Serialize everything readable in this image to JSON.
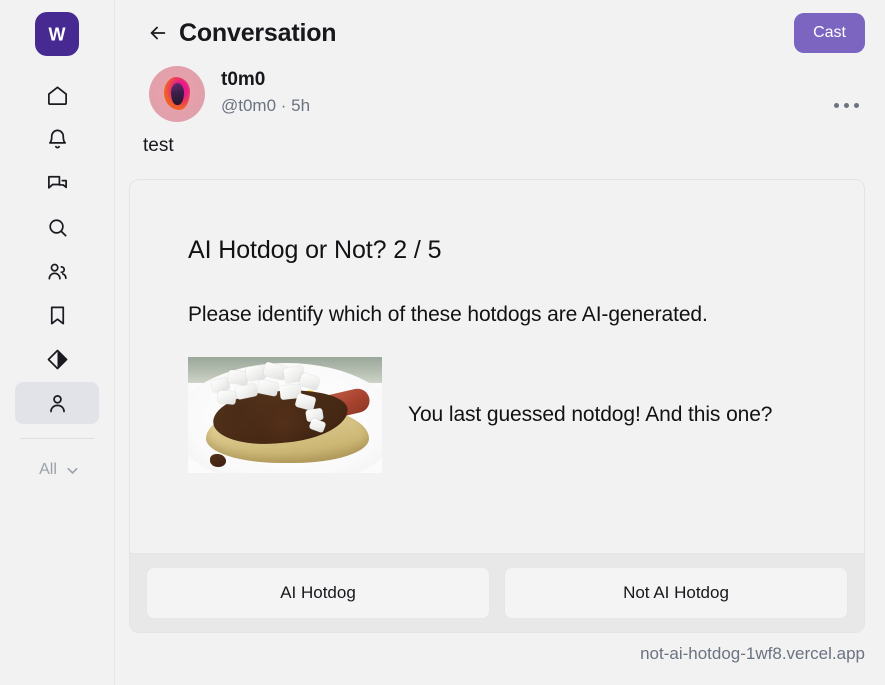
{
  "sidebar": {
    "logo_letter": "W",
    "logo_color": "#472A91",
    "items": [
      {
        "icon": "home-icon",
        "name": "home",
        "active": false
      },
      {
        "icon": "bell-icon",
        "name": "notifications",
        "active": false
      },
      {
        "icon": "chat-icon",
        "name": "messages",
        "active": false
      },
      {
        "icon": "search-icon",
        "name": "search",
        "active": false
      },
      {
        "icon": "users-icon",
        "name": "channels",
        "active": false
      },
      {
        "icon": "bookmark-icon",
        "name": "bookmarks",
        "active": false
      },
      {
        "icon": "diamond-icon",
        "name": "explore",
        "active": false
      },
      {
        "icon": "person-icon",
        "name": "profile",
        "active": true
      }
    ],
    "filter": {
      "label": "All",
      "icon": "chevron-down-icon"
    }
  },
  "header": {
    "back_icon": "arrow-left-icon",
    "title": "Conversation",
    "cast_label": "Cast",
    "cast_color": "#7C65C1"
  },
  "post": {
    "display_name": "t0m0",
    "handle": "@t0m0 · 5h",
    "text": "test",
    "more_icon": "more-horizontal-icon",
    "avatar_name": "avatar"
  },
  "frame": {
    "title": "AI Hotdog or Not? 2 / 5",
    "subtitle": "Please identify which of these hotdogs are AI-generated.",
    "caption": "You last guessed notdog! And this one?",
    "image_alt": "chili-dog-photo",
    "buttons": [
      {
        "label": "AI Hotdog"
      },
      {
        "label": "Not AI Hotdog"
      }
    ],
    "url": "not-ai-hotdog-1wf8.vercel.app"
  }
}
